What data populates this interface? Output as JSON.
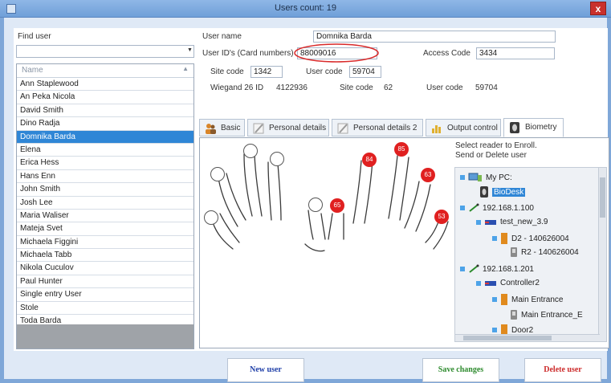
{
  "window": {
    "title": "Users count: 19",
    "close_label": "x"
  },
  "find_user": {
    "label": "Find user",
    "value": ""
  },
  "user_list": {
    "header": "Name",
    "items": [
      "Ann Staplewood",
      "An Peka Nicola",
      "David Smith",
      "Dino Radja",
      "Domnika Barda",
      "Elena",
      "Erica Hess",
      "Hans Enn",
      "John Smith",
      "Josh Lee",
      "Maria Waliser",
      "Mateja Svet",
      "Michaela Figgini",
      "Michaela Tabb",
      "Nikola Cuculov",
      "Paul Hunter",
      "Single entry User",
      "Stole",
      "Toda Barda"
    ],
    "selected": "Domnika Barda"
  },
  "details": {
    "user_name_label": "User name",
    "user_name_value": "Domnika Barda",
    "user_ids_label": "User ID's (Card numbers)",
    "user_ids_value": "88009016",
    "access_code_label": "Access Code",
    "access_code_value": "3434",
    "site_code_label": "Site code",
    "site_code_value": "1342",
    "user_code_label": "User code",
    "user_code_value": "59704",
    "wiegand_label": "Wiegand 26  ID",
    "wiegand_value": "4122936",
    "wiegand_site_label": "Site code",
    "wiegand_site_value": "62",
    "wiegand_user_label": "User code",
    "wiegand_user_value": "59704"
  },
  "tabs": [
    {
      "label": "Basic",
      "icon": "people-icon"
    },
    {
      "label": "Personal details",
      "icon": "pen-icon"
    },
    {
      "label": "Personal details 2",
      "icon": "pen-icon"
    },
    {
      "label": "Output control",
      "icon": "chart-icon"
    },
    {
      "label": "Biometry",
      "icon": "fingerprint-icon",
      "active": true
    }
  ],
  "biometry": {
    "instruction_line1": "Select reader to Enroll.",
    "instruction_line2": "Send or Delete user",
    "fingers": [
      {
        "finger": "left-pinky",
        "enrolled": false,
        "value": ""
      },
      {
        "finger": "left-ring",
        "enrolled": false,
        "value": ""
      },
      {
        "finger": "left-middle",
        "enrolled": false,
        "value": ""
      },
      {
        "finger": "left-index",
        "enrolled": false,
        "value": ""
      },
      {
        "finger": "left-thumb",
        "enrolled": false,
        "value": ""
      },
      {
        "finger": "right-thumb",
        "enrolled": true,
        "value": "65"
      },
      {
        "finger": "right-index",
        "enrolled": true,
        "value": "84"
      },
      {
        "finger": "right-middle",
        "enrolled": true,
        "value": "85"
      },
      {
        "finger": "right-ring",
        "enrolled": true,
        "value": "63"
      },
      {
        "finger": "right-pinky",
        "enrolled": true,
        "value": "53"
      }
    ],
    "tree": {
      "root": "My PC:",
      "biodesk": "BioDesk",
      "ip1": "192.168.1.100",
      "device1": "test_new_3.9",
      "d2": "D2 - 140626004",
      "r2": "R2 - 140626004",
      "ip2": "192.168.1.201",
      "controller": "Controller2",
      "main_entrance": "Main Entrance",
      "main_entrance_b": "Main Entrance_E",
      "door2": "Door2"
    }
  },
  "buttons": {
    "new_user": "New user",
    "save_changes": "Save changes",
    "delete_user": "Delete user"
  },
  "colors": {
    "selection": "#2f86d6",
    "enrolled": "#e02020",
    "new_user": "#1f3fa8",
    "save": "#2e8b2e",
    "delete": "#cc2a2a",
    "highlight_ellipse": "#d92a2a"
  }
}
